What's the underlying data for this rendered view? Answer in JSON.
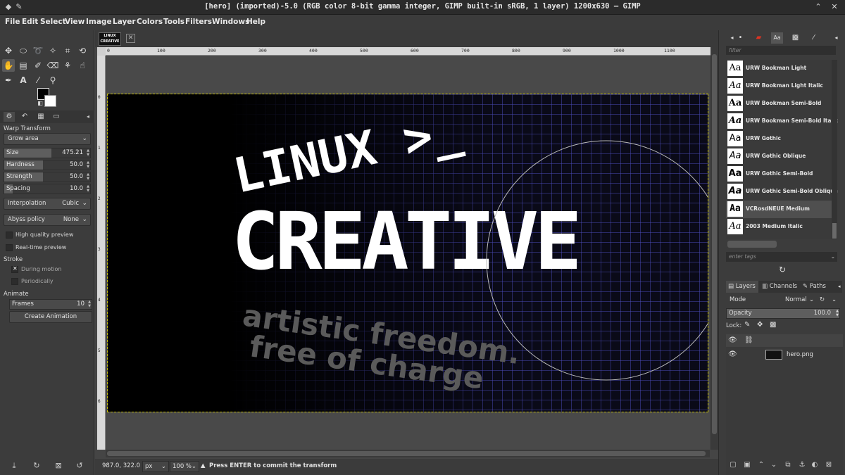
{
  "window": {
    "title": "[hero] (imported)-5.0 (RGB color 8-bit gamma integer, GIMP built-in sRGB, 1 layer) 1200x630 – GIMP"
  },
  "menu": [
    "File",
    "Edit",
    "Select",
    "View",
    "Image",
    "Layer",
    "Colors",
    "Tools",
    "Filters",
    "Windows",
    "Help"
  ],
  "tool_options": {
    "title": "Warp Transform",
    "mode": "Grow area",
    "size_label": "Size",
    "size_value": "475.21",
    "hardness_label": "Hardness",
    "hardness_value": "50.0",
    "strength_label": "Strength",
    "strength_value": "50.0",
    "spacing_label": "Spacing",
    "spacing_value": "10.0",
    "interpolation_label": "Interpolation",
    "interpolation_value": "Cubic",
    "abyss_label": "Abyss policy",
    "abyss_value": "None",
    "hq_preview": "High quality preview",
    "realtime_preview": "Real-time preview",
    "stroke_label": "Stroke",
    "during_motion": "During motion",
    "periodically": "Periodically",
    "animate_label": "Animate",
    "frames_label": "Frames",
    "frames_value": "10",
    "create_animation": "Create Animation"
  },
  "image_tab": {
    "thumb_text": "LINUX CREATIVE"
  },
  "ruler": {
    "h": [
      "0",
      "100",
      "200",
      "300",
      "400",
      "500",
      "600",
      "700",
      "800",
      "900",
      "1000",
      "1100"
    ],
    "v": [
      "0",
      "1",
      "2",
      "3",
      "4",
      "5",
      "6"
    ]
  },
  "canvas": {
    "line1": "LINUX >_",
    "line2": "CREATIVE",
    "line3": "artistic freedom.",
    "line4": "free of charge"
  },
  "status": {
    "coords": "987.0, 322.0",
    "unit": "px",
    "zoom": "100 %",
    "message": "Press ENTER to commit the transform"
  },
  "fonts": {
    "filter_placeholder": "filter",
    "tag_placeholder": "enter tags",
    "items": [
      "URW Bookman Light",
      "URW Bookman Light Italic",
      "URW Bookman Semi-Bold",
      "URW Bookman Semi-Bold Italic",
      "URW Gothic",
      "URW Gothic Oblique",
      "URW Gothic Semi-Bold",
      "URW Gothic Semi-Bold Oblique",
      "VCRosdNEUE Medium",
      "2003 Medium Italic"
    ],
    "selected_index": 8
  },
  "layers": {
    "tabs": [
      "Layers",
      "Channels",
      "Paths"
    ],
    "mode_label": "Mode",
    "mode_value": "Normal",
    "opacity_label": "Opacity",
    "opacity_value": "100.0",
    "lock_label": "Lock:",
    "items": [
      "hero.png"
    ]
  },
  "colors": {
    "canvas_grid": "#3a3aa0",
    "selection": "#c8c000"
  }
}
